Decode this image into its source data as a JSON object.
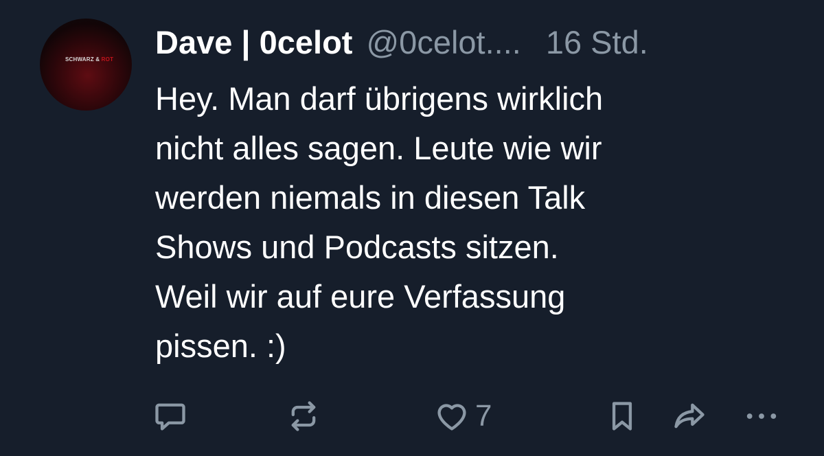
{
  "tweet": {
    "avatar": {
      "icon": "schwarz-rot-logo-avatar",
      "logo_text_white": "SCHWARZ & ",
      "logo_text_red": "ROT",
      "colors": {
        "red": "#c4141c",
        "dark": "#0a0a0c"
      }
    },
    "display_name": "Dave | 0celot",
    "handle": "@0celot....",
    "time": "16 Std.",
    "text": "Hey. Man darf übrigens wirklich\nnicht alles sagen. Leute wie wir\nwerden niemals in diesen Talk\nShows und Podcasts sitzen.\nWeil wir auf eure Verfassung\npissen. :)"
  },
  "actions": {
    "reply_icon": "reply-icon",
    "repost_icon": "repost-icon",
    "like_icon": "heart-icon",
    "like_count": "7",
    "bookmark_icon": "bookmark-icon",
    "share_icon": "share-icon",
    "more_icon": "more-icon"
  },
  "colors": {
    "background": "#161e2b",
    "text": "#ffffff",
    "muted": "#8b98a5"
  }
}
